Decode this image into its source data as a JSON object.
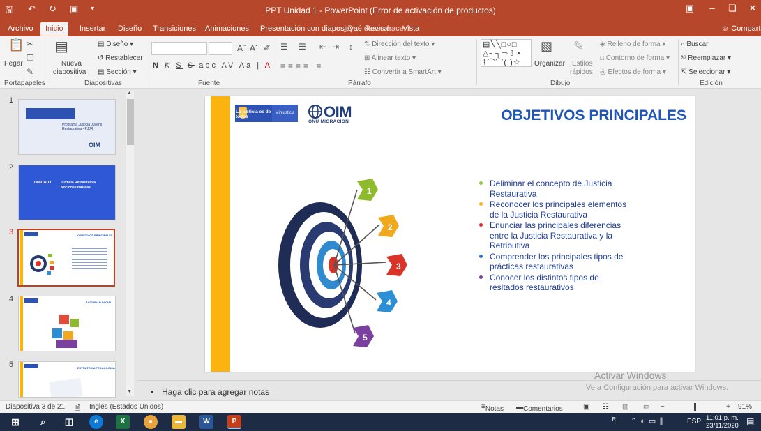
{
  "window": {
    "title": "PPT Unidad 1 - PowerPoint (Error de activación de productos)"
  },
  "tabs": [
    "Archivo",
    "Inicio",
    "Insertar",
    "Diseño",
    "Transiciones",
    "Animaciones",
    "Presentación con diapositivas",
    "Revisar",
    "Vista"
  ],
  "tell_me": "¿Qué desea hacer?",
  "share": "Compartir",
  "ribbon": {
    "portapapeles": {
      "group": "Portapapeles",
      "pegar": "Pegar"
    },
    "diapositivas": {
      "group": "Diapositivas",
      "nueva": "Nueva",
      "diapositiva": "diapositiva",
      "diseno": "Diseño",
      "restablecer": "Restablecer",
      "seccion": "Sección"
    },
    "fuente": {
      "group": "Fuente",
      "bold": "N",
      "italic": "K",
      "underline": "S",
      "strike": "S",
      "abc": "abc",
      "spacing": "AV",
      "case": "Aa",
      "color": "A"
    },
    "parrafo": {
      "group": "Párrafo",
      "direccion": "Dirección del texto",
      "alinear": "Alinear texto",
      "smartart": "Convertir a SmartArt"
    },
    "dibujo": {
      "group": "Dibujo",
      "organizar": "Organizar",
      "estilos": "Estilos",
      "rapidos": "rápidos",
      "relleno": "Relleno de forma",
      "contorno": "Contorno de forma",
      "efectos": "Efectos de forma"
    },
    "edicion": {
      "group": "Edición",
      "buscar": "Buscar",
      "reemplazar": "Reemplazar",
      "seleccionar": "Seleccionar"
    }
  },
  "thumbnails": [
    {
      "num": "1",
      "lines": [
        "Programa Justicia Juvenil",
        "Restaurativa - PJJR"
      ],
      "brand": "OIM"
    },
    {
      "num": "2",
      "unit": "UNIDAD I",
      "lines": [
        "Justicia Restaurativa",
        "Nociones Básicas"
      ]
    },
    {
      "num": "3",
      "title": "OBJETIVOS PRINCIPALES"
    },
    {
      "num": "4",
      "title": "ACTIVIDAD INICIAL"
    },
    {
      "num": "5",
      "title": "ESTRATEGIA PEDAGÓGICA"
    }
  ],
  "slide": {
    "title": "OBJETIVOS PRINCIPALES",
    "logo_justicia": "La justicia es de todos",
    "logo_min": "Minjusticia",
    "logo_oim": "OIM",
    "logo_oim_sub": "ONU MIGRACIÓN",
    "arrows": [
      "1",
      "2",
      "3",
      "4",
      "5"
    ],
    "arrow_colors": [
      "#8dbb2b",
      "#f0a81c",
      "#d9332a",
      "#2c8fd6",
      "#7b3fa0"
    ],
    "objectives": [
      {
        "text": "Deliminar el concepto de Justicia Restaurativa",
        "color": "#8dc63f"
      },
      {
        "text": "Reconocer los principales elementos de la Justicia Restaurativa",
        "color": "#fbb40f"
      },
      {
        "text": "Enunciar las principales diferencias entre la Justicia Restaurativa y la Retributiva",
        "color": "#e3262d"
      },
      {
        "text": "Comprender los principales tipos de prácticas restaurativas",
        "color": "#1f78c8"
      },
      {
        "text": "Conocer los distintos tipos de resltados restaurativos",
        "color": "#7e3fa1"
      }
    ]
  },
  "notes": {
    "placeholder": "Haga clic para agregar notas"
  },
  "watermark": {
    "line1": "Activar Windows",
    "line2": "Ve a Configuración para activar Windows."
  },
  "status": {
    "slide": "Diapositiva 3 de 21",
    "language": "Inglés (Estados Unidos)",
    "notes": "Notas",
    "comments": "Comentarios",
    "zoom": "91%"
  },
  "taskbar": {
    "lang": "ESP",
    "time": "11:01 p. m.",
    "date": "23/11/2020"
  }
}
